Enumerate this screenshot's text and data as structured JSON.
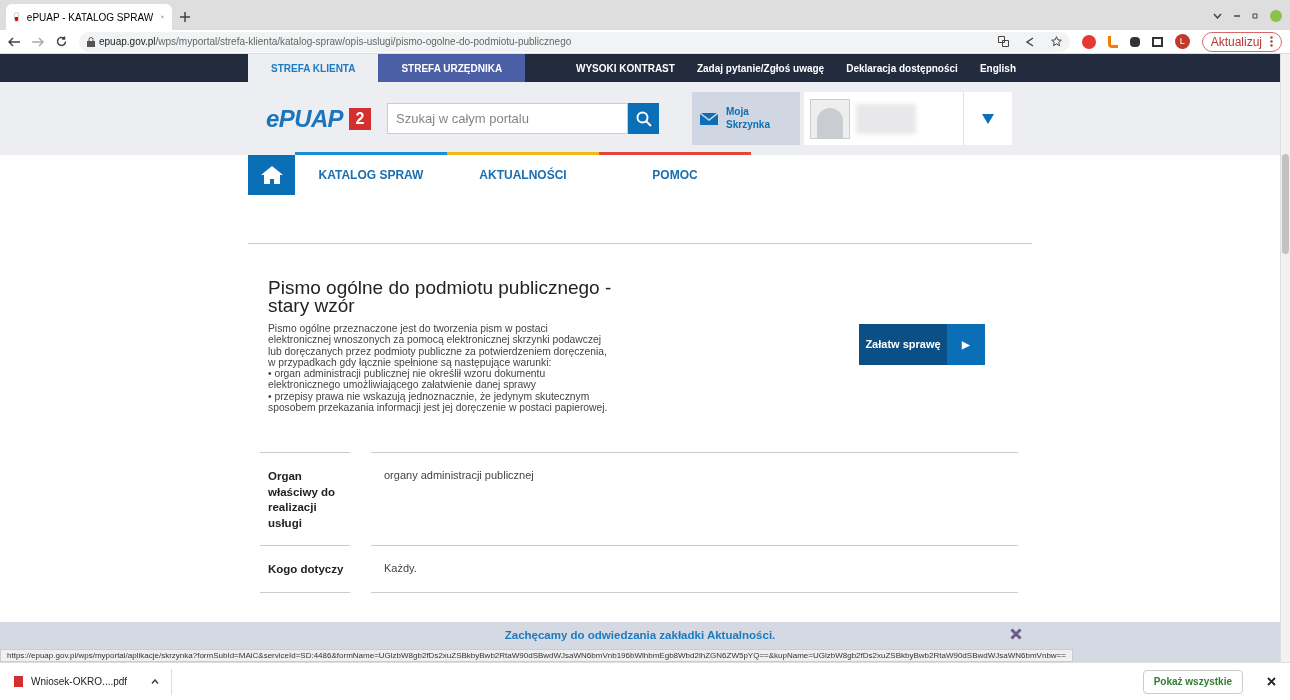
{
  "browser": {
    "tabs": [
      {
        "title": "ePUAP - KATALOG SPRAW",
        "selected": true
      }
    ],
    "url_host": "epuap.gov.pl",
    "url_path": "/wps/myportal/strefa-klienta/katalog-spraw/opis-uslugi/pismo-ogolne-do-podmiotu-publicznego",
    "update_button": "Aktualizuj",
    "profile_initial": "L"
  },
  "top_bar": {
    "zones": [
      {
        "label": "STREFA KLIENTA",
        "selected": true
      },
      {
        "label": "STREFA URZĘDNIKA",
        "selected": false
      }
    ],
    "links": [
      "WYSOKI KONTRAST",
      "Zadaj pytanie/Zgłoś uwagę",
      "Deklaracja dostępności",
      "English"
    ]
  },
  "header": {
    "logo_text": "ePUAP",
    "logo_badge": "2",
    "search": {
      "placeholder": "Szukaj w całym portalu"
    },
    "mailbox": "Moja Skrzynka"
  },
  "nav": [
    {
      "label": "KATALOG SPRAW",
      "color": "#1a8fd8"
    },
    {
      "label": "AKTUALNOŚCI",
      "color": "#f0b81c"
    },
    {
      "label": "POMOC",
      "color": "#e2473b"
    }
  ],
  "service": {
    "title": "Pismo ogólne do podmiotu publicznego - stary wzór",
    "description": [
      "Pismo ogólne przeznaczone jest do tworzenia pism w postaci elektronicznej wnoszonych za pomocą elektronicznej skrzynki podawczej lub doręczanych przez podmioty publiczne za potwierdzeniem doręczenia, w przypadkach gdy łącznie spełnione są następujące warunki:",
      "• organ administracji publicznej nie określił wzoru dokumentu elektronicznego umożliwiającego załatwienie danej sprawy",
      "• przepisy prawa nie wskazują jednoznacznie, że jedynym skutecznym sposobem przekazania informacji jest jej doręczenie w postaci papierowej."
    ],
    "action_button": "Załatw sprawę",
    "action_icon": "▶"
  },
  "details": [
    {
      "label": "Organ właściwy do realizacji usługi",
      "value": "organy administracji publicznej"
    },
    {
      "label": "Kogo dotyczy",
      "value": "Każdy."
    }
  ],
  "banner": {
    "lines": [
      "Zachęcamy do odwiedzania zakładki Aktualności."
    ]
  },
  "status_url": "https://epuap.gov.pl/wps/myportal/aplikacje/skrzynka?formSubId=MAiC&serviceId=SD:4486&formName=UGlzbW8gb2fDs2xuZSBkbyBwb2RtaW90dSBwdWJsaWN6bmVnb196bWlhbmEgb8Wbd2lhZGN6ZW5pYQ==&kupName=UGlzbW8gb2fDs2xuZSBkbyBwb2RtaW90dSBwdWJsaWN6bmVnbw==",
  "downloads": {
    "items": [
      "Wniosek-OKRO....pdf"
    ],
    "show_all": "Pokaż wszystkie"
  }
}
